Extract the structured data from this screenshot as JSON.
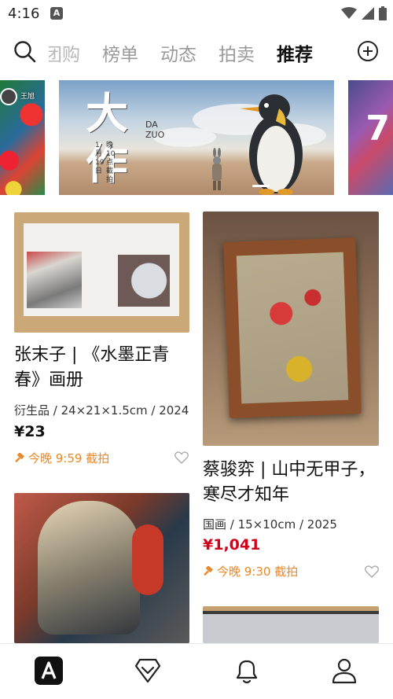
{
  "status": {
    "time": "4:16",
    "app_icon": "A"
  },
  "nav": {
    "tabs": [
      "团购",
      "榜单",
      "动态",
      "拍卖",
      "推荐"
    ],
    "active_tab": "推荐"
  },
  "banner": {
    "left_user": "王旭",
    "title_cn": "大作",
    "title_pinyin_1": "DA",
    "title_pinyin_2": "ZUO",
    "date_text": "1月19日",
    "date_sub": "晚10点截拍"
  },
  "feed": [
    {
      "title_line1": "张末子 | 《水墨正青",
      "title_line2": "春》画册",
      "meta": "衍生品 / 24×21×1.5cm / 2024",
      "price": "¥23",
      "auction": "今晚 9:59 截拍"
    },
    {
      "title_line1": "蔡骏弈 | 山中无甲子，",
      "title_line2": "寒尽才知年",
      "meta": "国画 / 15×10cm / 2025",
      "price": "¥1,041",
      "auction": "今晚 9:30 截拍"
    }
  ],
  "colors": {
    "accent_orange": "#e8892b",
    "price_red": "#d0021b",
    "active_tab": "#111111",
    "inactive_tab": "#9a9a9a"
  },
  "bottom_nav": {
    "icons": [
      "home-app-icon",
      "shop-diamond-icon",
      "bell-icon",
      "profile-icon"
    ]
  }
}
